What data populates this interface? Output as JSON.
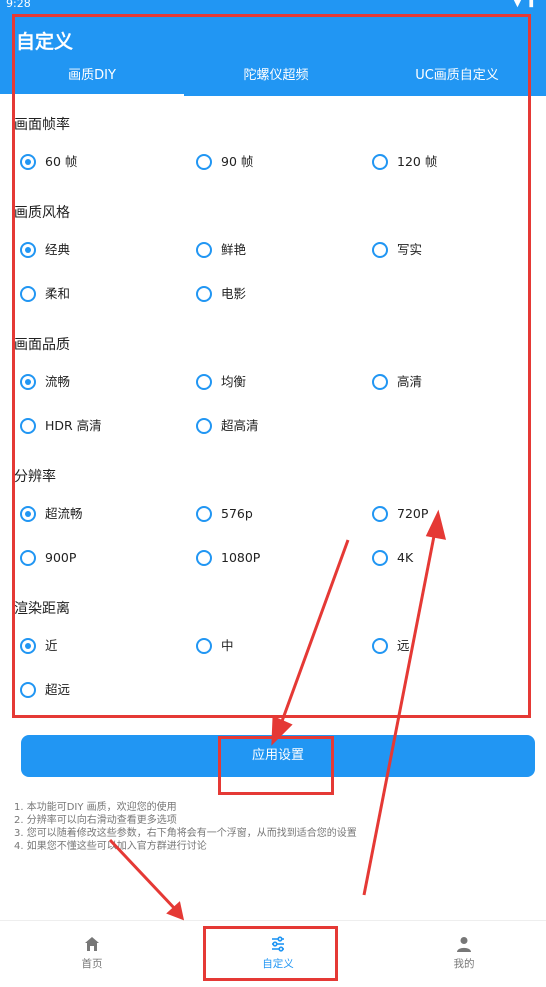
{
  "status_bar": {
    "time": "9:28"
  },
  "header": {
    "title": "自定义",
    "tabs": [
      {
        "label": "画质DIY",
        "active": true
      },
      {
        "label": "陀螺仪超频",
        "active": false
      },
      {
        "label": "UC画质自定义",
        "active": false
      }
    ]
  },
  "sections": [
    {
      "title": "画面帧率",
      "options": [
        {
          "label": "60 帧",
          "checked": true
        },
        {
          "label": "90 帧",
          "checked": false
        },
        {
          "label": "120 帧",
          "checked": false
        }
      ]
    },
    {
      "title": "画质风格",
      "options": [
        {
          "label": "经典",
          "checked": true
        },
        {
          "label": "鲜艳",
          "checked": false
        },
        {
          "label": "写实",
          "checked": false
        },
        {
          "label": "柔和",
          "checked": false
        },
        {
          "label": "电影",
          "checked": false
        }
      ]
    },
    {
      "title": "画面品质",
      "options": [
        {
          "label": "流畅",
          "checked": true
        },
        {
          "label": "均衡",
          "checked": false
        },
        {
          "label": "高清",
          "checked": false
        },
        {
          "label": "HDR 高清",
          "checked": false
        },
        {
          "label": "超高清",
          "checked": false
        }
      ]
    },
    {
      "title": "分辨率",
      "options": [
        {
          "label": "超流畅",
          "checked": true
        },
        {
          "label": "576p",
          "checked": false
        },
        {
          "label": "720P",
          "checked": false
        },
        {
          "label": "900P",
          "checked": false
        },
        {
          "label": "1080P",
          "checked": false
        },
        {
          "label": "4K",
          "checked": false
        }
      ]
    },
    {
      "title": "渲染距离",
      "options": [
        {
          "label": "近",
          "checked": true
        },
        {
          "label": "中",
          "checked": false
        },
        {
          "label": "远",
          "checked": false
        },
        {
          "label": "超远",
          "checked": false
        }
      ]
    }
  ],
  "apply_button": {
    "label": "应用设置"
  },
  "notes": [
    "1. 本功能可DIY 画质，欢迎您的使用",
    "2. 分辨率可以向右滑动查看更多选项",
    "3. 您可以随着修改这些参数，右下角将会有一个浮窗，从而找到适合您的设置",
    "4. 如果您不懂这些可以加入官方群进行讨论"
  ],
  "bottom_nav": [
    {
      "label": "首页",
      "icon": "home-icon",
      "active": false
    },
    {
      "label": "自定义",
      "icon": "sliders-icon",
      "active": true
    },
    {
      "label": "我的",
      "icon": "person-icon",
      "active": false
    }
  ],
  "colors": {
    "primary": "#2196F3",
    "annotation": "#e53935"
  }
}
